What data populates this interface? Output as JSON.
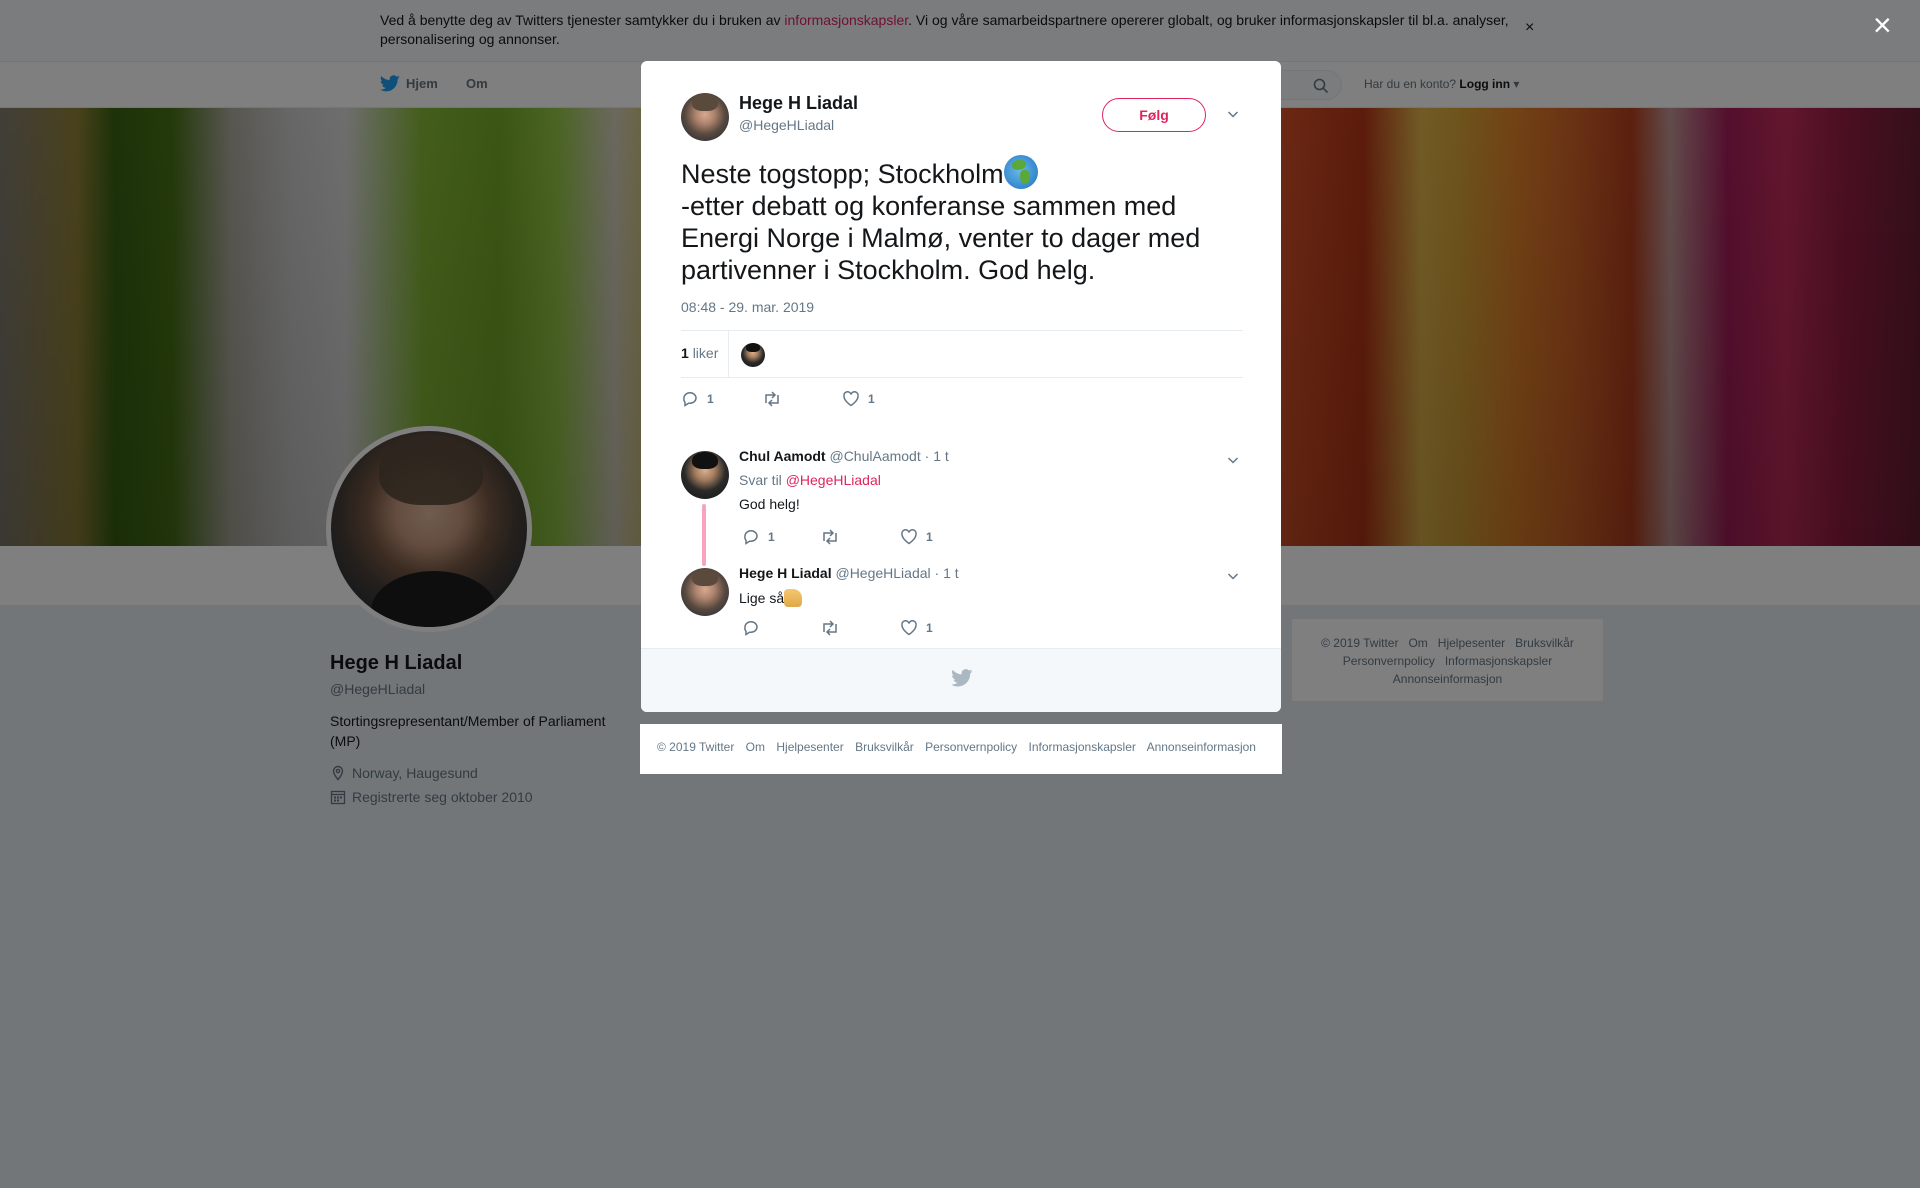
{
  "cookie_banner": {
    "text_before": "Ved å benytte deg av Twitters tjenester samtykker du i bruken av ",
    "link": "informasjonskapsler",
    "text_after": ". Vi og våre samarbeidspartnere opererer globalt, og bruker informasjonskapsler til bl.a. analyser, personalisering og annonser.",
    "close": "×"
  },
  "nav": {
    "home": "Hjem",
    "about": "Om",
    "account_prompt": "Har du en konto?",
    "login": "Logg inn"
  },
  "profile": {
    "name": "Hege H Liadal",
    "handle": "@HegeHLiadal",
    "bio": "Stortingsrepresentant/Member of Parliament (MP)",
    "location": "Norway, Haugesund",
    "joined": "Registrerte seg oktober 2010"
  },
  "sidebar_footer": {
    "links_row1": [
      "© 2019 Twitter",
      "Om",
      "Hjelpesenter",
      "Bruksvilkår"
    ],
    "links_row2": [
      "Personvernpolicy",
      "Informasjonskapsler"
    ],
    "links_row3": [
      "Annonseinformasjon"
    ]
  },
  "modal_close": "×",
  "tweet": {
    "author_name": "Hege H Liadal",
    "author_handle": "@HegeHLiadal",
    "follow_label": "Følg",
    "text_line1": "Neste togstopp; Stockholm",
    "text_rest": "-etter debatt og konferanse sammen med Energi Norge i Malmø, venter to dager med partivenner i Stockholm. God helg.",
    "timestamp": "08:48 - 29. mar. 2019",
    "likes_count": "1",
    "likes_label": "liker",
    "reply_count": "1",
    "like_count": "1"
  },
  "replies": [
    {
      "name": "Chul Aamodt",
      "handle": "@ChulAamodt",
      "time": "· 1 t",
      "replying_prefix": "Svar til",
      "replying_to": "@HegeHLiadal",
      "text": "God helg!",
      "reply_count": "1",
      "like_count": "1"
    },
    {
      "name": "Hege H Liadal",
      "handle": "@HegeHLiadal",
      "time": "· 1 t",
      "text": "Lige så",
      "like_count": "1"
    }
  ],
  "legal_footer": [
    "© 2019 Twitter",
    "Om",
    "Hjelpesenter",
    "Bruksvilkår",
    "Personvernpolicy",
    "Informasjonskapsler",
    "Annonseinformasjon"
  ],
  "colors": {
    "accent": "#e0245e",
    "twitter_blue": "#1da1f2",
    "muted": "#657786"
  }
}
